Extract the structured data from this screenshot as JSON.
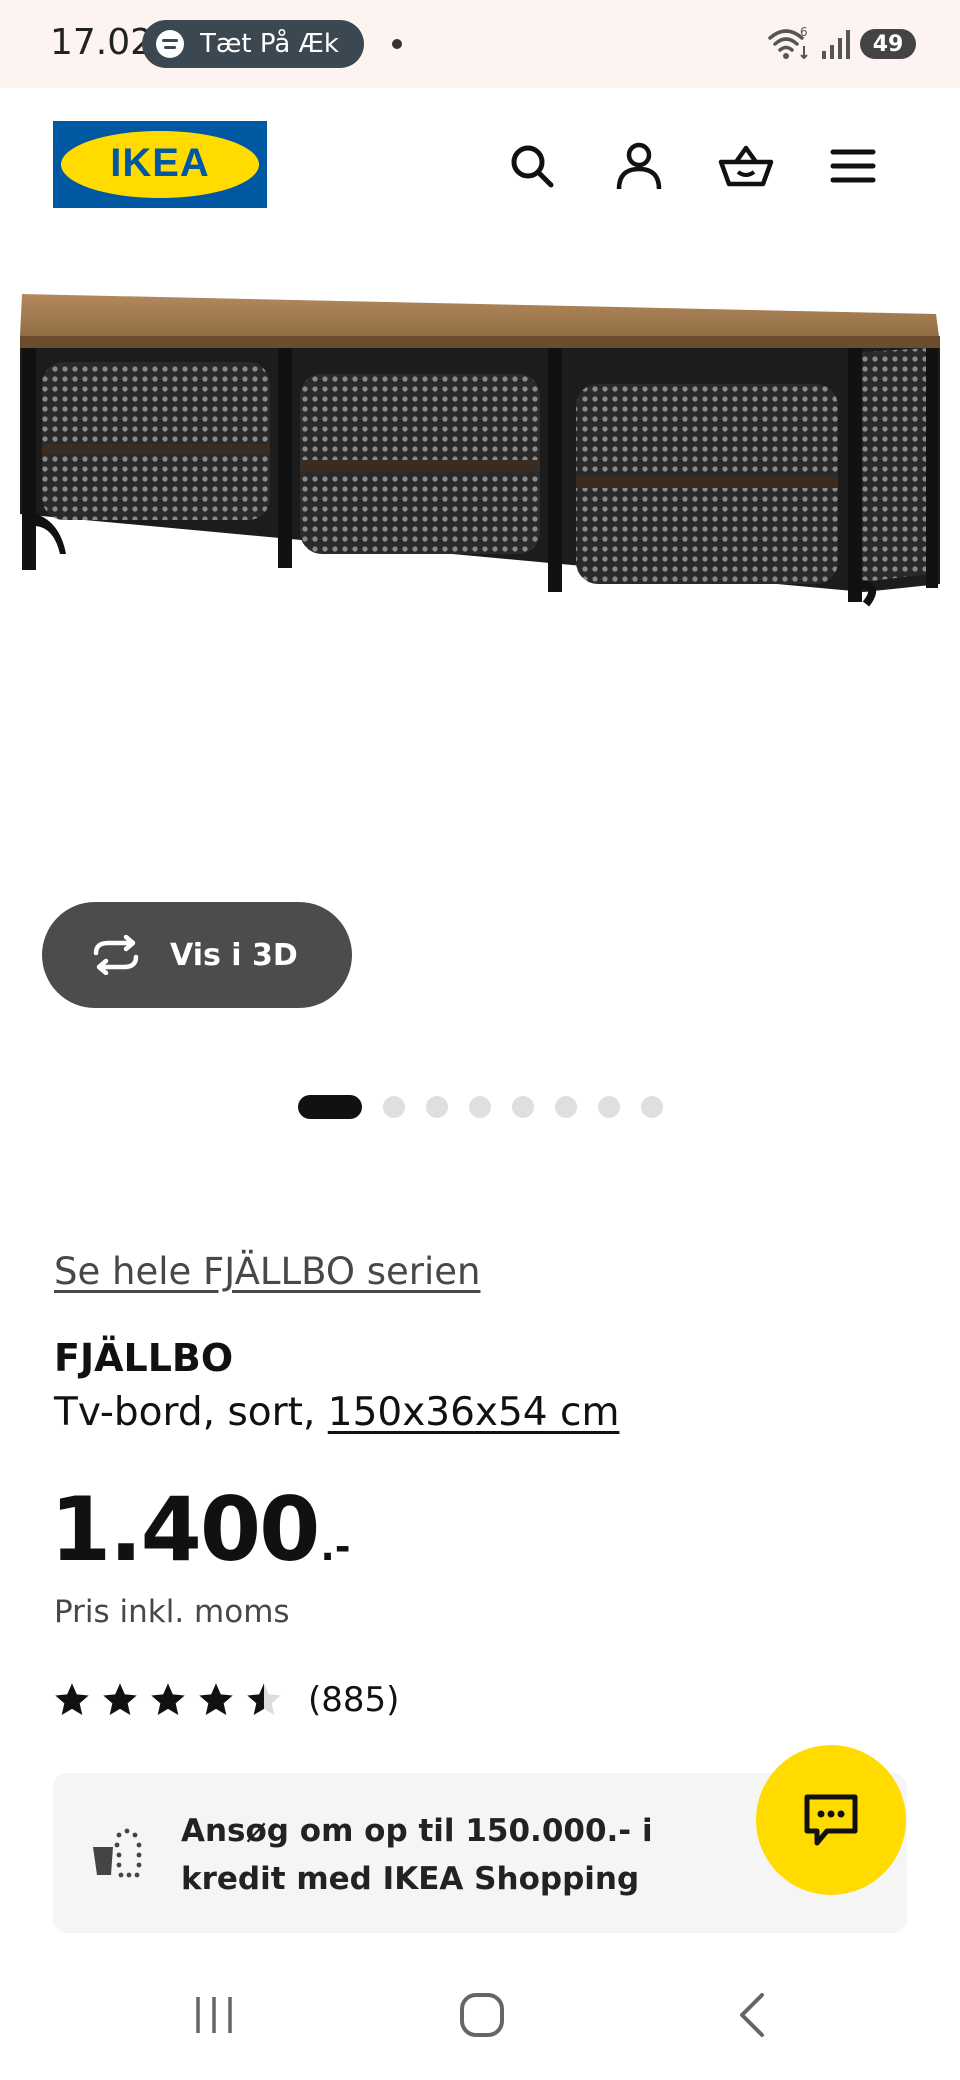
{
  "status_bar": {
    "time": "17.02",
    "media_pill_text": "Tæt På Æk",
    "wifi_label": "6",
    "battery": "49"
  },
  "header": {
    "logo_text": "IKEA",
    "icons": [
      "search-icon",
      "account-icon",
      "basket-icon",
      "menu-icon"
    ]
  },
  "gallery": {
    "view_3d_label": "Vis i 3D",
    "image_count": 8,
    "active_index": 0
  },
  "product": {
    "series_link": "Se hele FJÄLLBO serien",
    "name": "FJÄLLBO",
    "description_prefix": "Tv-bord, sort, ",
    "dimensions": "150x36x54 cm",
    "price_main": "1.400",
    "price_suffix": ".-",
    "vat_note": "Pris inkl. moms",
    "rating": 4.5,
    "rating_max": 5,
    "review_count": "(885)"
  },
  "credit_banner": {
    "text": "Ansøg om op til 150.000.- i kredit med IKEA Shopping"
  },
  "colors": {
    "ikea_blue": "#0058a3",
    "ikea_yellow": "#ffdb00",
    "text": "#111111",
    "muted": "#484848"
  }
}
